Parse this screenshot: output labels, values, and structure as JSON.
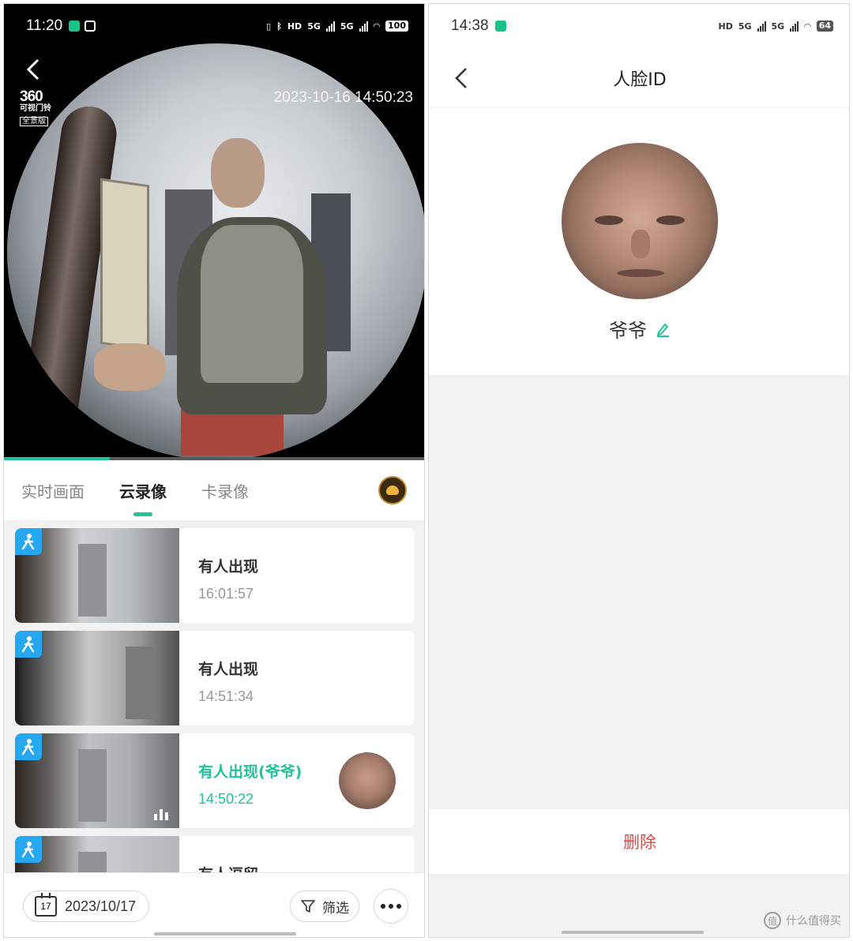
{
  "left": {
    "status_bar": {
      "time": "11:20",
      "network": "HD",
      "gen1": "5G",
      "gen2": "5G",
      "battery": "100"
    },
    "video": {
      "logo_number": "360",
      "logo_sub": "可视门铃",
      "logo_tag": "全景版",
      "timestamp": "2023-10-16 14:50:23",
      "progress": 0.25
    },
    "tabs": [
      {
        "label": "实时画面",
        "active": false
      },
      {
        "label": "云录像",
        "active": true
      },
      {
        "label": "卡录像",
        "active": false
      }
    ],
    "events": [
      {
        "title": "有人出现",
        "time": "16:01:57",
        "highlight": false,
        "face": false
      },
      {
        "title": "有人出现",
        "time": "14:51:34",
        "highlight": false,
        "face": false
      },
      {
        "title": "有人出现(爷爷)",
        "time": "14:50:22",
        "highlight": true,
        "face": true
      },
      {
        "title": "有人逗留",
        "time": "",
        "highlight": false,
        "face": false
      }
    ],
    "bottom": {
      "calendar_day": "17",
      "date": "2023/10/17",
      "filter_label": "筛选"
    },
    "colors": {
      "accent": "#1fc29a",
      "motion_badge": "#26a7f2"
    }
  },
  "right": {
    "status_bar": {
      "time": "14:38",
      "network": "HD",
      "gen1": "5G",
      "gen2": "5G",
      "battery": "64"
    },
    "header": {
      "title": "人脸ID"
    },
    "profile": {
      "name": "爷爷"
    },
    "delete_label": "删除",
    "watermark": {
      "logo": "值",
      "text": "什么值得买"
    },
    "colors": {
      "delete": "#e24a4a",
      "edit_icon": "#1fc29a"
    }
  }
}
